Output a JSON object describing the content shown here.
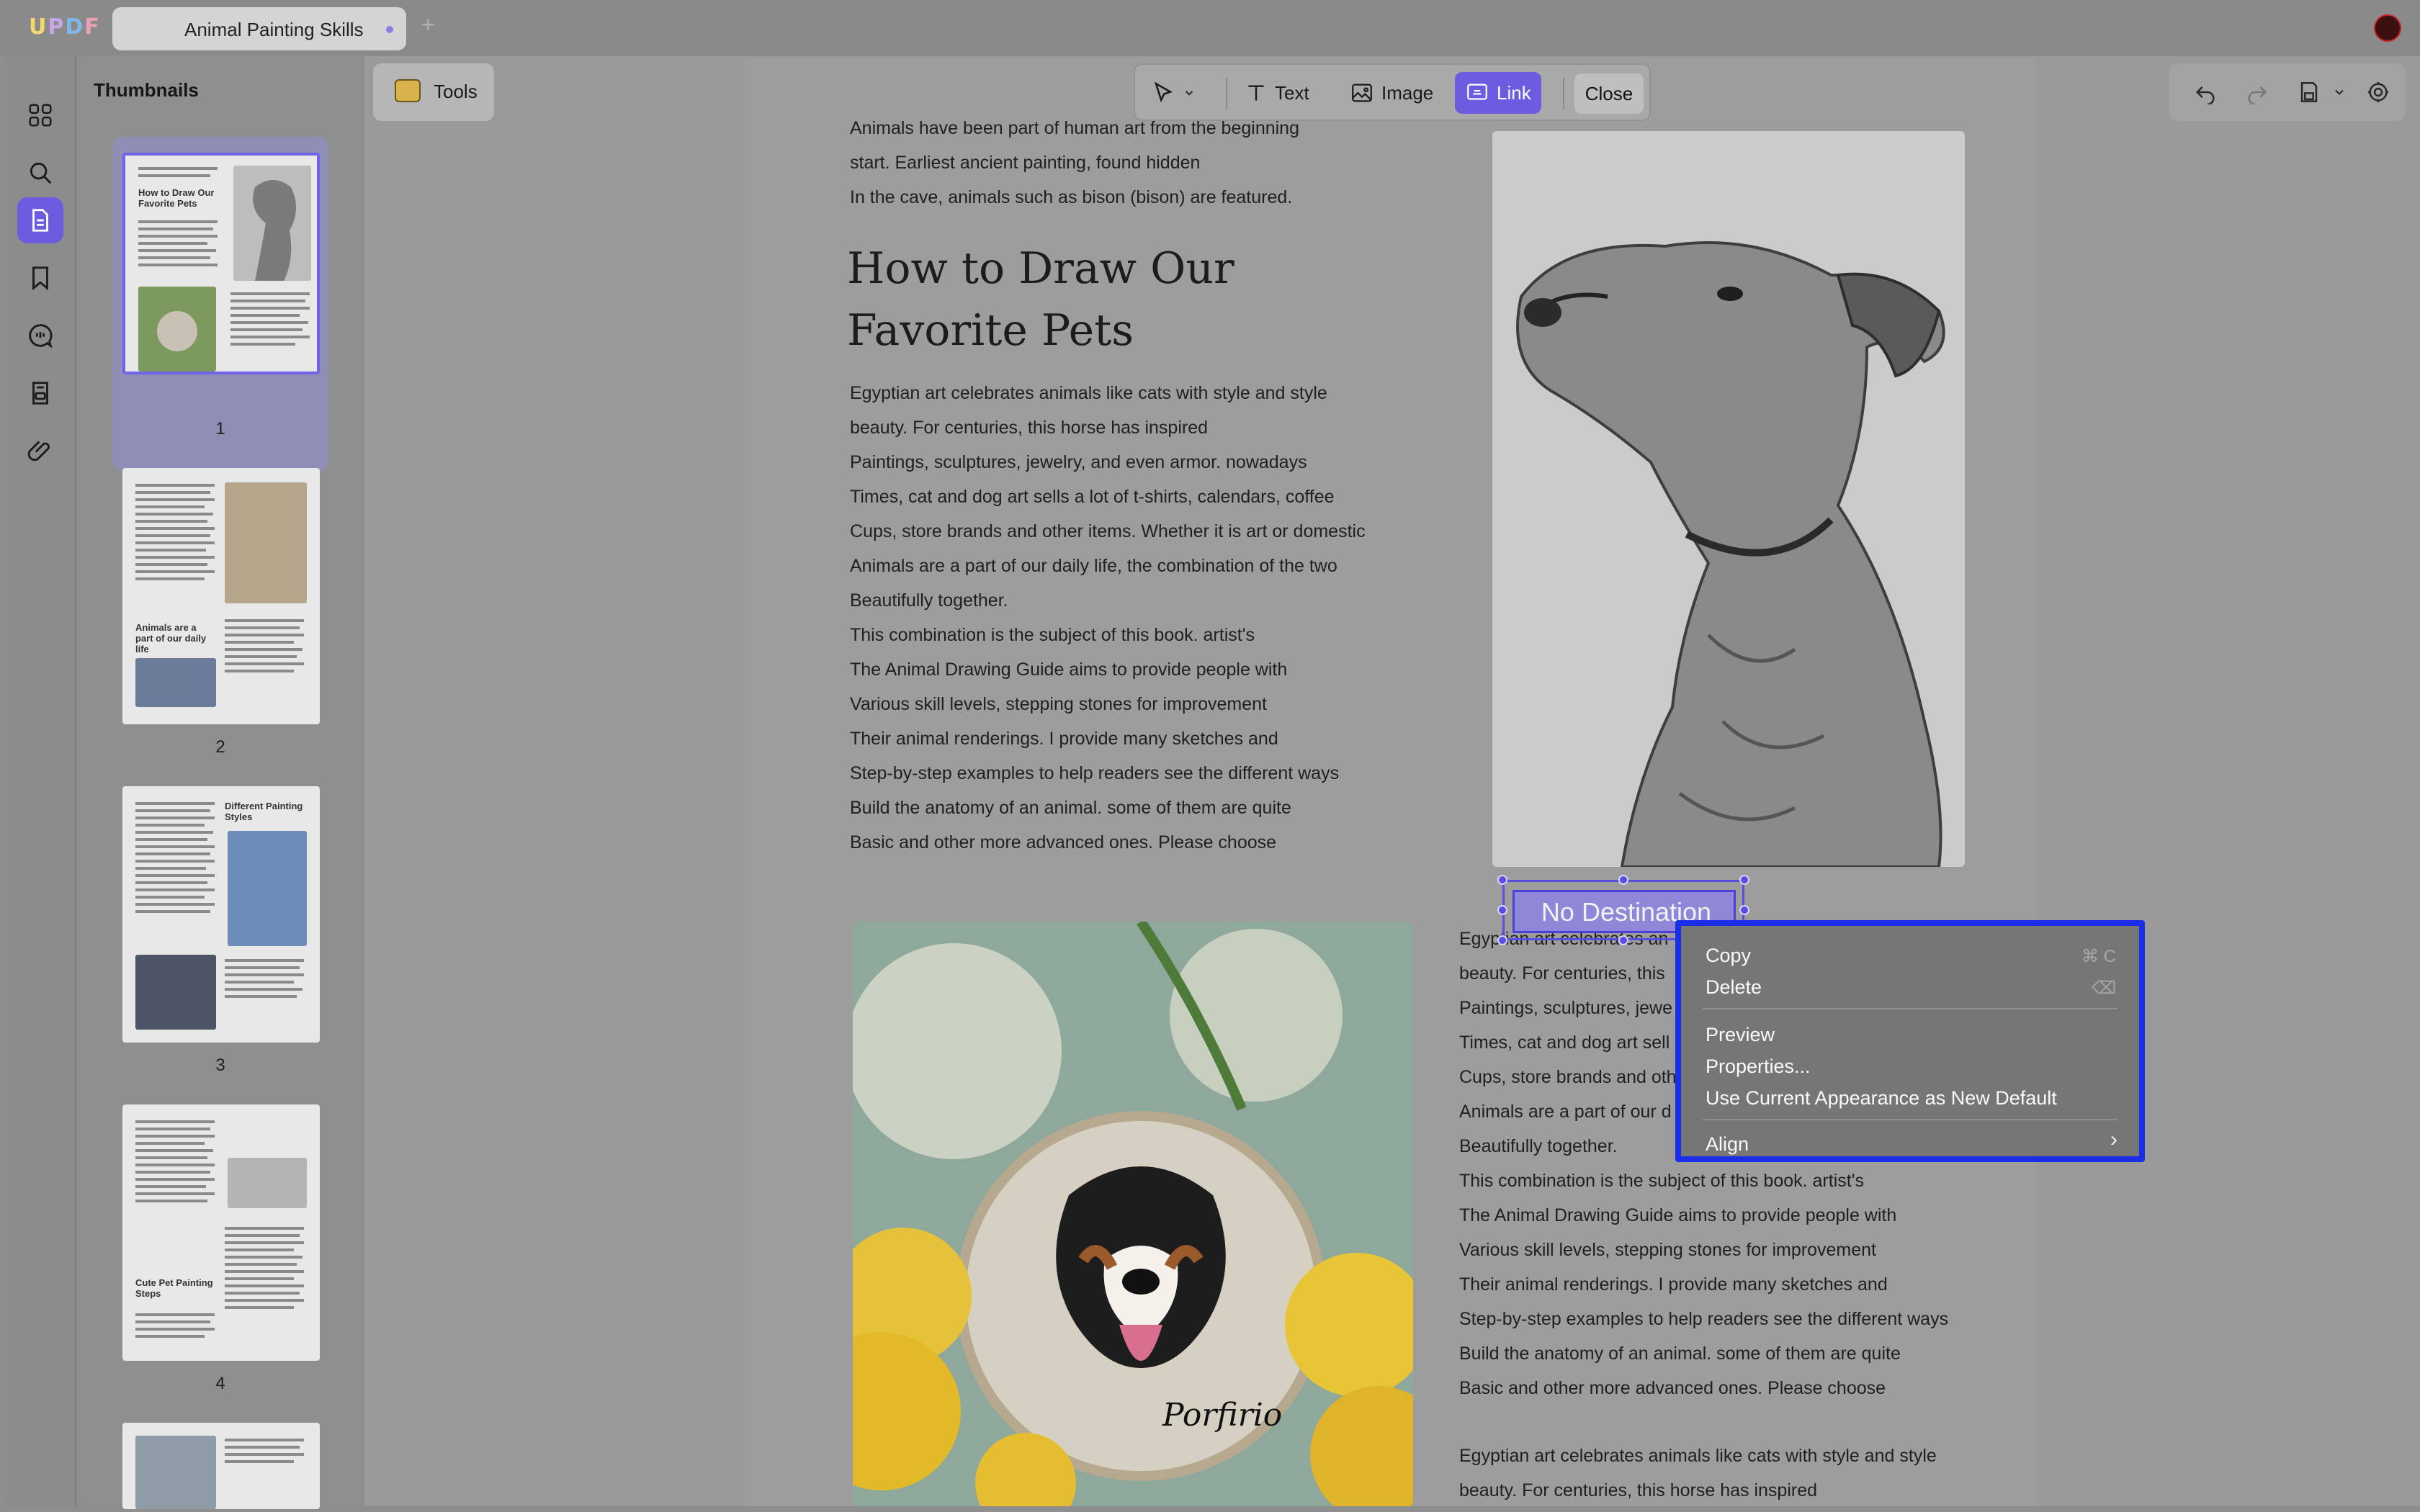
{
  "app": {
    "logo": "UPDF",
    "tab_title": "Animal Painting Skills",
    "tab_add": "+"
  },
  "thumbnails": {
    "title": "Thumbnails",
    "pages": [
      {
        "num": "1",
        "heading": "How to Draw Our Favorite Pets"
      },
      {
        "num": "2",
        "heading": "Animals are a part of our daily life"
      },
      {
        "num": "3",
        "heading": "Different Painting Styles"
      },
      {
        "num": "4",
        "heading": "Cute Pet Painting Steps"
      }
    ]
  },
  "tools": {
    "label": "Tools"
  },
  "toolbar": {
    "text": "Text",
    "image": "Image",
    "link": "Link",
    "close": "Close"
  },
  "page": {
    "intro": [
      "Animals have been part of human art from the beginning",
      "start. Earliest ancient painting, found hidden",
      "In the cave, animals such as bison (bison) are featured."
    ],
    "heading_line1": "How to Draw Our",
    "heading_line2": "Favorite Pets",
    "body": [
      "Egyptian art celebrates animals like cats with style and style",
      "beauty. For centuries, this horse has inspired",
      "Paintings, sculptures, jewelry, and even armor. nowadays",
      "Times, cat and dog art sells a lot of t-shirts, calendars, coffee",
      "Cups, store brands and other items. Whether it is art or domestic",
      "Animals are a part of our daily life, the combination of the two",
      "Beautifully together.",
      "This combination is the subject of this book. artist's",
      "The Animal Drawing Guide aims to provide people with",
      "Various skill levels, stepping stones for improvement",
      "Their animal renderings. I provide many sketches and",
      "Step-by-step examples to help readers see the different ways",
      "Build the anatomy of an animal. some of them are quite",
      "Basic and other more advanced ones. Please choose"
    ],
    "right_col": [
      "Egyptian art celebrates an",
      "beauty. For centuries, this",
      "Paintings, sculptures, jewe",
      "Times, cat and dog art sell",
      "Cups, store brands and oth",
      "Animals are a part of our d",
      "Beautifully together.",
      "This combination is the subject of this book. artist's",
      "The Animal Drawing Guide aims to provide people with",
      "Various skill levels, stepping stones for improvement",
      "Their animal renderings. I provide many sketches and",
      "Step-by-step examples to help readers see the different ways",
      "Build the anatomy of an animal. some of them are quite",
      "Basic and other more advanced ones. Please choose"
    ],
    "bottom": [
      "Egyptian art celebrates animals like cats with style and style",
      "beauty. For centuries, this horse has inspired"
    ],
    "embroidery_name": "Porfirio"
  },
  "link": {
    "label": "No Destination"
  },
  "context_menu": {
    "copy": "Copy",
    "copy_shortcut": "⌘ C",
    "delete": "Delete",
    "delete_shortcut": "⌫",
    "preview": "Preview",
    "properties": "Properties...",
    "use_default": "Use Current Appearance as New Default",
    "align": "Align",
    "align_arrow": "›"
  },
  "colors": {
    "accent": "#6b5ce0",
    "menu_border": "#1a2ee8"
  }
}
